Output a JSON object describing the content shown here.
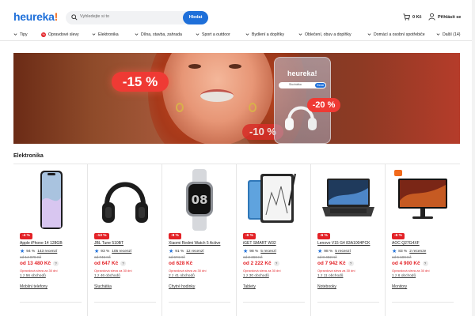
{
  "header": {
    "logo": "heureka",
    "logo_bang": "!",
    "search_placeholder": "Vyhledejte si to",
    "search_button": "Hledat",
    "cart_price": "0 Kč",
    "login": "Přihlásit se"
  },
  "nav": {
    "items": [
      {
        "label": "Tipy",
        "icon": "chevron-down-icon"
      },
      {
        "label": "Opravdové slevy",
        "icon": "percent-badge-icon"
      },
      {
        "label": "Elektronika",
        "icon": "chevron-down-icon"
      },
      {
        "label": "Dílna, stavba, zahrada",
        "icon": "chevron-down-icon"
      },
      {
        "label": "Sport a outdoor",
        "icon": "chevron-down-icon"
      },
      {
        "label": "Bydlení a doplňky",
        "icon": "chevron-down-icon"
      },
      {
        "label": "Oblečení, obuv a doplňky",
        "icon": "chevron-down-icon"
      },
      {
        "label": "Domácí a osobní spotřebiče",
        "icon": "chevron-down-icon"
      },
      {
        "label": "Další (14)",
        "icon": "chevron-down-icon"
      }
    ]
  },
  "banner": {
    "discount_big": "-15 %",
    "discount_mid": "-20 %",
    "discount_small": "-10 %",
    "phone_logo": "heureka!",
    "phone_search": "Sluchátka",
    "phone_button": "Hledat"
  },
  "section": {
    "title": "Elektronika"
  },
  "products": [
    {
      "discount": "-4 %",
      "name": "Apple iPhone 14 128GB",
      "rating": "94 %",
      "reviews": "143 recenzí",
      "old_price": "od 14 079 Kč",
      "price": "od 13 480 Kč",
      "note": "Opravdová sleva za 30 dní",
      "shops": "1 z 56 obchodů",
      "category": "Mobilní telefony",
      "image": "iphone"
    },
    {
      "discount": "-13 %",
      "name": "JBL Tune 510BT",
      "rating": "93 %",
      "reviews": "105 recenzí",
      "old_price": "od 746 Kč",
      "price": "od 647 Kč",
      "note": "Opravdová sleva za 30 dní",
      "shops": "1 z 46 obchodů",
      "category": "Sluchátka",
      "image": "headphones"
    },
    {
      "discount": "-8 %",
      "name": "Xiaomi Redmi Watch 5 Active",
      "rating": "91 %",
      "reviews": "12 recenzí",
      "old_price": "od 674 Kč",
      "price": "od 628 Kč",
      "note": "Opravdová sleva za 30 dní",
      "shops": "2 z 41 obchodů",
      "category": "Chytré hodinky",
      "image": "watch"
    },
    {
      "discount": "-6 %",
      "name": "iGET SMART W32",
      "rating": "98 %",
      "reviews": "5 recenzí",
      "old_price": "od 2 368 Kč",
      "price": "od 2 222 Kč",
      "note": "Opravdová sleva za 30 dní",
      "shops": "1 z 30 obchodů",
      "category": "Tablety",
      "image": "tablet"
    },
    {
      "discount": "-6 %",
      "name": "Lenovo V15 G4 83A1004PCK",
      "rating": "98 %",
      "reviews": "5 recenzí",
      "old_price": "od 8 452 Kč",
      "price": "od 7 942 Kč",
      "note": "Opravdová sleva za 30 dní",
      "shops": "1 z 11 obchodů",
      "category": "Notebooky",
      "image": "laptop"
    },
    {
      "discount": "-6 %",
      "name": "AOC Q27G4XF",
      "rating": "83 %",
      "reviews": "2 recenze",
      "old_price": "od 5 199 Kč",
      "price": "od 4 900 Kč",
      "note": "Opravdová sleva za 30 dní",
      "shops": "1 z 6 obchodů",
      "category": "Monitory",
      "image": "monitor"
    }
  ]
}
